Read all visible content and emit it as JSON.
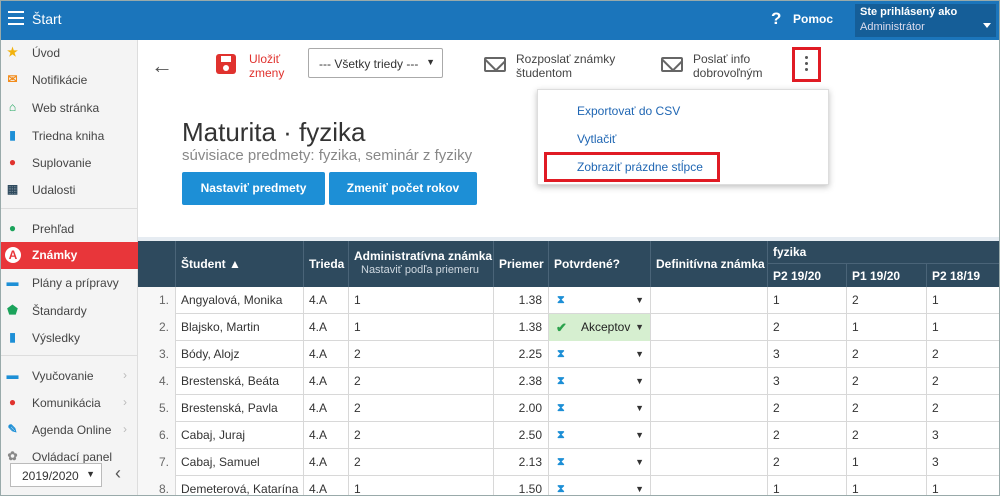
{
  "topbar": {
    "title": "Štart",
    "help_label": "Pomoc",
    "user_line1": "Ste prihlásený ako",
    "user_line2": "Administrátor"
  },
  "sidebar": {
    "items": [
      {
        "label": "Úvod",
        "icon": "star-icon",
        "color": "#f2b20d"
      },
      {
        "label": "Notifikácie",
        "icon": "envelope-icon",
        "color": "#f28c1b"
      },
      {
        "label": "Web stránka",
        "icon": "home-icon",
        "color": "#1ba35b"
      },
      {
        "label": "Triedna kniha",
        "icon": "book-icon",
        "color": "#1d8fd6"
      },
      {
        "label": "Suplovanie",
        "icon": "user-swap-icon",
        "color": "#e0322e"
      },
      {
        "label": "Udalosti",
        "icon": "calendar-icon",
        "color": "#2e4a5e"
      },
      {
        "label": "Prehľad",
        "icon": "check-circle-icon",
        "color": "#1ba35b"
      },
      {
        "label": "Známky",
        "icon": "grade-icon",
        "color": "#e8363a"
      },
      {
        "label": "Plány a prípravy",
        "icon": "plan-icon",
        "color": "#1d8fd6"
      },
      {
        "label": "Štandardy",
        "icon": "shield-icon",
        "color": "#1ba35b"
      },
      {
        "label": "Výsledky",
        "icon": "bar-chart-icon",
        "color": "#1d8fd6"
      },
      {
        "label": "Vyučovanie",
        "icon": "briefcase-icon",
        "color": "#1d8fd6"
      },
      {
        "label": "Komunikácia",
        "icon": "chat-icon",
        "color": "#e0322e"
      },
      {
        "label": "Agenda Online",
        "icon": "pen-icon",
        "color": "#1d8fd6"
      },
      {
        "label": "Ovládací panel",
        "icon": "gear-icon",
        "color": "#888888"
      }
    ],
    "year": "2019/2020"
  },
  "toolbar": {
    "save_line1": "Uložiť",
    "save_line2": "zmeny",
    "class_filter": "--- Všetky triedy ---",
    "send_grades_line1": "Rozposlať známky",
    "send_grades_line2": "študentom",
    "send_info_line1": "Poslať info",
    "send_info_line2": "dobrovoľným"
  },
  "menu": {
    "export_csv": "Exportovať do CSV",
    "print": "Vytlačiť",
    "show_empty": "Zobraziť prázdne stĺpce"
  },
  "page": {
    "title": "Maturita · fyzika",
    "subtitle": "súvisiace predmety: fyzika, seminár z fyziky",
    "btn_subjects": "Nastaviť predmety",
    "btn_years": "Zmeniť počet rokov"
  },
  "table": {
    "headers": {
      "student": "Študent ▲",
      "class": "Trieda",
      "admin_grade": "Administratívna známka",
      "admin_grade_sub": "Nastaviť podľa priemeru",
      "average": "Priemer",
      "confirmed": "Potvrdené?",
      "final_grade": "Definitívna známka",
      "subject_group": "fyzika",
      "period_cols": [
        "P2 19/20",
        "P1 19/20",
        "P2 18/19"
      ]
    },
    "rows": [
      {
        "n": "1.",
        "name": "Angyalová, Monika",
        "class": "4.A",
        "admin": "1",
        "avg": "1.38",
        "confirmed": "",
        "final": "",
        "g": [
          "1",
          "2",
          "1"
        ]
      },
      {
        "n": "2.",
        "name": "Blajsko, Martin",
        "class": "4.A",
        "admin": "1",
        "avg": "1.38",
        "confirmed": "Akceptov",
        "final": "",
        "g": [
          "2",
          "1",
          "1"
        ]
      },
      {
        "n": "3.",
        "name": "Bódy, Alojz",
        "class": "4.A",
        "admin": "2",
        "avg": "2.25",
        "confirmed": "",
        "final": "",
        "g": [
          "3",
          "2",
          "2"
        ]
      },
      {
        "n": "4.",
        "name": "Brestenská, Beáta",
        "class": "4.A",
        "admin": "2",
        "avg": "2.38",
        "confirmed": "",
        "final": "",
        "g": [
          "3",
          "2",
          "2"
        ]
      },
      {
        "n": "5.",
        "name": "Brestenská, Pavla",
        "class": "4.A",
        "admin": "2",
        "avg": "2.00",
        "confirmed": "",
        "final": "",
        "g": [
          "2",
          "2",
          "2"
        ]
      },
      {
        "n": "6.",
        "name": "Cabaj, Juraj",
        "class": "4.A",
        "admin": "2",
        "avg": "2.50",
        "confirmed": "",
        "final": "",
        "g": [
          "2",
          "2",
          "3"
        ]
      },
      {
        "n": "7.",
        "name": "Cabaj, Samuel",
        "class": "4.A",
        "admin": "2",
        "avg": "2.13",
        "confirmed": "",
        "final": "",
        "g": [
          "2",
          "1",
          "3"
        ]
      },
      {
        "n": "8.",
        "name": "Demeterová, Katarína",
        "class": "4.A",
        "admin": "1",
        "avg": "1.50",
        "confirmed": "",
        "final": "",
        "g": [
          "1",
          "1",
          "1"
        ]
      }
    ]
  }
}
